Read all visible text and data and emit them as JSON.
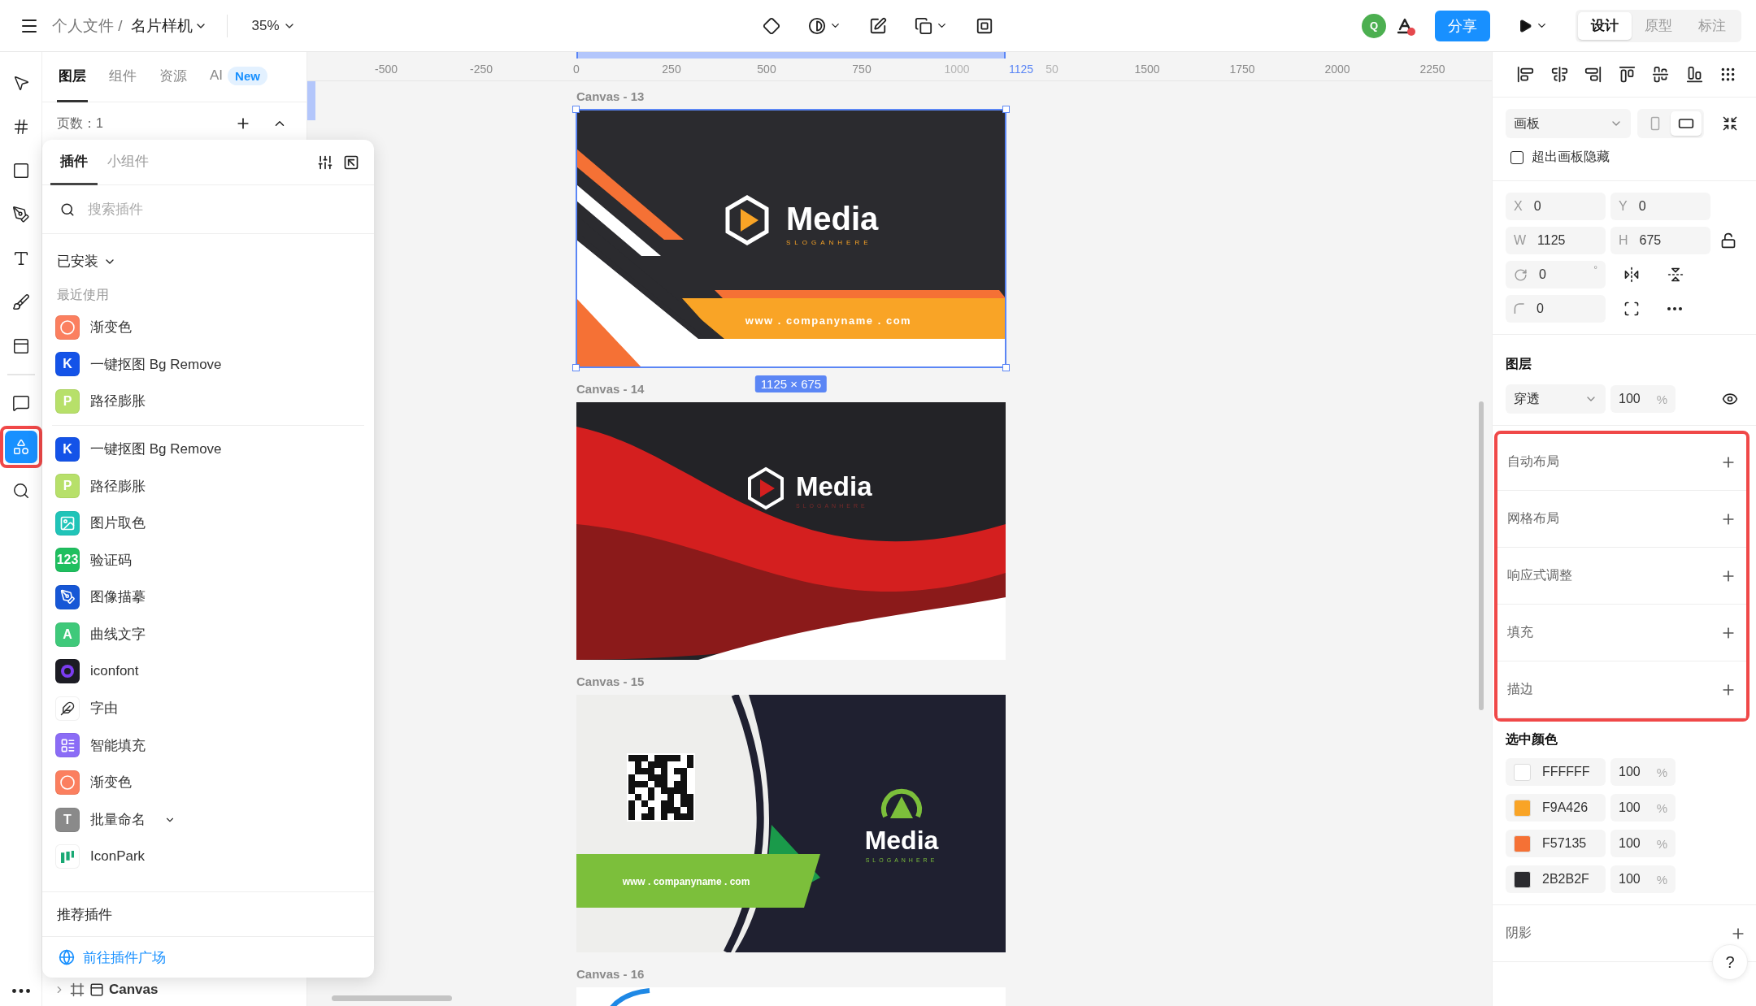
{
  "topbar": {
    "breadcrumb_parent": "个人文件 /",
    "file_name": "名片样机",
    "zoom": "35%",
    "avatar": "Q",
    "share": "分享",
    "modes": [
      {
        "label": "设计",
        "selected": true
      },
      {
        "label": "原型",
        "selected": false
      },
      {
        "label": "标注",
        "selected": false
      }
    ]
  },
  "tools": [
    {
      "kind": "move",
      "selected": false,
      "highlighted": false
    },
    {
      "kind": "frame",
      "selected": false,
      "highlighted": false
    },
    {
      "kind": "shape",
      "selected": false,
      "highlighted": false
    },
    {
      "kind": "pen",
      "selected": false,
      "highlighted": false
    },
    {
      "kind": "text",
      "selected": false,
      "highlighted": false
    },
    {
      "kind": "brush",
      "selected": false,
      "highlighted": false
    },
    {
      "kind": "section",
      "selected": false,
      "highlighted": false
    },
    {
      "kind": "comment",
      "selected": false,
      "highlighted": false
    },
    {
      "kind": "plugin",
      "selected": true,
      "highlighted": true
    },
    {
      "kind": "search",
      "selected": false,
      "highlighted": false
    }
  ],
  "left_panel": {
    "tabs": [
      {
        "label": "图层",
        "selected": true
      },
      {
        "label": "组件",
        "selected": false
      },
      {
        "label": "资源",
        "selected": false
      },
      {
        "label": "AI",
        "selected": false,
        "badge": "New"
      }
    ],
    "page_count": "页数：1",
    "layer": "Canvas"
  },
  "plugin_popup": {
    "tabs": [
      {
        "label": "插件",
        "selected": true
      },
      {
        "label": "小组件",
        "selected": false
      }
    ],
    "search": {
      "placeholder": "搜索插件"
    },
    "filter": "已安装",
    "recent_heading": "最近使用",
    "recent": [
      {
        "name": "渐变色",
        "kind": "ring",
        "color": "#fb7f5f",
        "expandable": false
      },
      {
        "name": "一键抠图 Bg Remove",
        "kind": "letter",
        "icon_text": "K",
        "color": "#1453e8",
        "expandable": false
      },
      {
        "name": "路径膨胀",
        "kind": "letter",
        "icon_text": "P",
        "color": "#b7e06a",
        "expandable": false
      }
    ],
    "installed": [
      {
        "name": "一键抠图 Bg Remove",
        "kind": "letter",
        "icon_text": "K",
        "color": "#1453e8",
        "expandable": false
      },
      {
        "name": "路径膨胀",
        "kind": "letter",
        "icon_text": "P",
        "color": "#b7e06a",
        "expandable": false
      },
      {
        "name": "图片取色",
        "kind": "picture",
        "color": "#20c4b8",
        "expandable": false
      },
      {
        "name": "验证码",
        "kind": "letter",
        "icon_text": "123",
        "color": "#1fbf5f",
        "expandable": false
      },
      {
        "name": "图像描摹",
        "kind": "pen",
        "color": "#1757d6",
        "expandable": false
      },
      {
        "name": "曲线文字",
        "kind": "letter",
        "icon_text": "A",
        "color": "#3fc97a",
        "expandable": false
      },
      {
        "name": "iconfont",
        "kind": "swirl",
        "color": "#1c1c24",
        "expandable": false
      },
      {
        "name": "字由",
        "kind": "feather",
        "color": "#ffffff",
        "expandable": false
      },
      {
        "name": "智能填充",
        "kind": "list",
        "color": "#8b6cf6",
        "expandable": false
      },
      {
        "name": "渐变色",
        "kind": "ring",
        "color": "#fb7f5f",
        "expandable": false
      },
      {
        "name": "批量命名",
        "kind": "letter",
        "icon_text": "T",
        "color": "#8a8a8a",
        "expandable": true
      },
      {
        "name": "IconPark",
        "kind": "bars",
        "color": "#ffffff",
        "expandable": false
      }
    ],
    "recommend": "推荐插件",
    "market_link": "前往插件广场"
  },
  "ruler": {
    "ticks": [
      {
        "label": "-500",
        "faint": false
      },
      {
        "label": "-250",
        "faint": false
      },
      {
        "label": "0",
        "faint": false
      },
      {
        "label": "250",
        "faint": false
      },
      {
        "label": "500",
        "faint": false
      },
      {
        "label": "750",
        "faint": false
      },
      {
        "label": "1000",
        "faint": true
      },
      {
        "label": "50",
        "faint": true
      },
      {
        "label": "1500",
        "faint": false
      },
      {
        "label": "1750",
        "faint": false
      },
      {
        "label": "2000",
        "faint": false
      },
      {
        "label": "2250",
        "faint": false
      }
    ],
    "selection_end": "1125"
  },
  "canvas": {
    "size_badge": "1125 × 675",
    "frames": [
      {
        "label": "Canvas - 13",
        "kind": "orange",
        "selected": true,
        "brand": "Media",
        "slogan": "SLOGANHERE",
        "url": "www . companyname . com"
      },
      {
        "label": "Canvas - 14",
        "kind": "red",
        "selected": false,
        "brand": "Media",
        "slogan": "SLOGANHERE"
      },
      {
        "label": "Canvas - 15",
        "kind": "green",
        "selected": false,
        "brand": "Media",
        "slogan": "SLOGANHERE",
        "url": "www . companyname . com"
      },
      {
        "label": "Canvas - 16",
        "kind": "partial",
        "selected": false
      }
    ]
  },
  "right_panel": {
    "frame_type": "画板",
    "orientation": [
      {
        "kind": "portrait",
        "selected": false
      },
      {
        "kind": "landscape",
        "selected": true
      }
    ],
    "clip_label": "超出画板隐藏",
    "clip_checked": false,
    "fields": [
      {
        "label": "X",
        "value": "0"
      },
      {
        "label": "Y",
        "value": "0"
      },
      {
        "label": "W",
        "value": "1125"
      },
      {
        "label": "H",
        "value": "675"
      }
    ],
    "rotation": "0",
    "rotation_unit": "°",
    "radius": "0",
    "layer_heading": "图层",
    "blend": "穿透",
    "opacity": "100",
    "opacity_unit": "%",
    "sections": {
      "highlighted": true,
      "items": [
        {
          "title": "自动布局"
        },
        {
          "title": "网格布局"
        },
        {
          "title": "响应式调整"
        },
        {
          "title": "填充"
        },
        {
          "title": "描边"
        }
      ]
    },
    "colors_heading": "选中颜色",
    "colors": [
      {
        "hex": "FFFFFF",
        "color": "#ffffff",
        "opacity": "100",
        "unit": "%"
      },
      {
        "hex": "F9A426",
        "color": "#f9a426",
        "opacity": "100",
        "unit": "%"
      },
      {
        "hex": "F57135",
        "color": "#f57135",
        "opacity": "100",
        "unit": "%"
      },
      {
        "hex": "2B2B2F",
        "color": "#2b2b2f",
        "opacity": "100",
        "unit": "%"
      }
    ],
    "shadow": "阴影",
    "help": "?"
  }
}
